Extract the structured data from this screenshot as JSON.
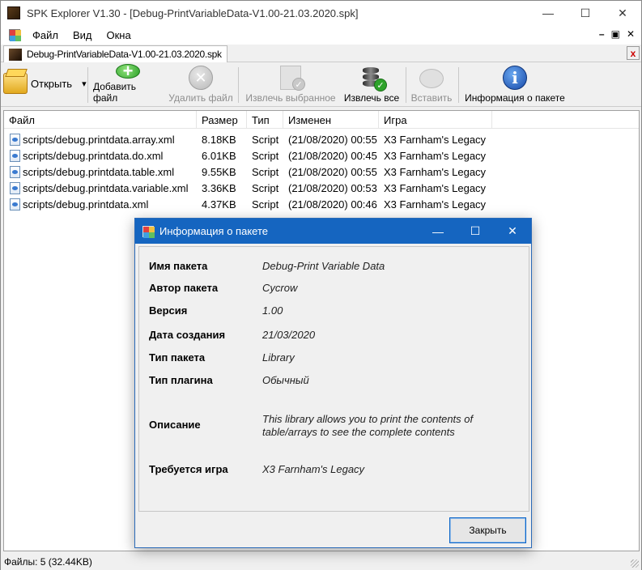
{
  "window": {
    "title": "SPK Explorer V1.30 - [Debug-PrintVariableData-V1.00-21.03.2020.spk]",
    "minimize": "—",
    "maximize": "☐",
    "close": "✕"
  },
  "menu": {
    "items": [
      "Файл",
      "Вид",
      "Окна"
    ],
    "mdi_minimize": "–",
    "mdi_restore": "▣",
    "mdi_close": "✕"
  },
  "doc_tab": {
    "label": "Debug-PrintVariableData-V1.00-21.03.2020.spk",
    "close": "x"
  },
  "toolbar": {
    "open": "Открыть",
    "open_arrow": "▾",
    "add_file": "Добавить файл",
    "remove_file": "Удалить файл",
    "extract_selected": "Извлечь выбранное",
    "extract_all": "Извлечь все",
    "paste": "Вставить",
    "package_info": "Информация о пакете"
  },
  "file_list": {
    "columns": [
      "Файл",
      "Размер",
      "Тип",
      "Изменен",
      "Игра"
    ],
    "rows": [
      {
        "file": "scripts/debug.printdata.array.xml",
        "size": "8.18KB",
        "type": "Script",
        "modified": "(21/08/2020) 00:55",
        "game": "X3 Farnham's Legacy"
      },
      {
        "file": "scripts/debug.printdata.do.xml",
        "size": "6.01KB",
        "type": "Script",
        "modified": "(21/08/2020) 00:45",
        "game": "X3 Farnham's Legacy"
      },
      {
        "file": "scripts/debug.printdata.table.xml",
        "size": "9.55KB",
        "type": "Script",
        "modified": "(21/08/2020) 00:55",
        "game": "X3 Farnham's Legacy"
      },
      {
        "file": "scripts/debug.printdata.variable.xml",
        "size": "3.36KB",
        "type": "Script",
        "modified": "(21/08/2020) 00:53",
        "game": "X3 Farnham's Legacy"
      },
      {
        "file": "scripts/debug.printdata.xml",
        "size": "4.37KB",
        "type": "Script",
        "modified": "(21/08/2020) 00:46",
        "game": "X3 Farnham's Legacy"
      }
    ]
  },
  "status": {
    "text": "Файлы: 5 (32.44KB)"
  },
  "dialog": {
    "title": "Информация о пакете",
    "fields": {
      "name_label": "Имя пакета",
      "name_value": "Debug-Print Variable Data",
      "author_label": "Автор пакета",
      "author_value": "Cycrow",
      "version_label": "Версия",
      "version_value": "1.00",
      "date_label": "Дата создания",
      "date_value": "21/03/2020",
      "type_label": "Тип пакета",
      "type_value": "Library",
      "plugin_label": "Тип плагина",
      "plugin_value": "Обычный",
      "desc_label": "Описание",
      "desc_value": "This library allows you to print the contents of table/arrays to see the complete contents",
      "game_label": "Требуется игра",
      "game_value": "X3 Farnham's Legacy"
    },
    "close_button": "Закрыть"
  }
}
